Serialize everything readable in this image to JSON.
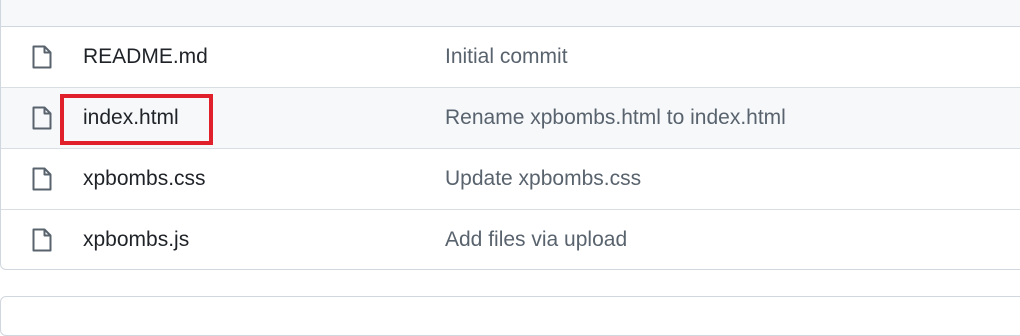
{
  "files": [
    {
      "name": "README.md",
      "commit_message": "Initial commit",
      "icon": "file-icon"
    },
    {
      "name": "index.html",
      "commit_message": "Rename xpbombs.html to index.html",
      "icon": "file-icon",
      "highlighted": true
    },
    {
      "name": "xpbombs.css",
      "commit_message": "Update xpbombs.css",
      "icon": "file-icon"
    },
    {
      "name": "xpbombs.js",
      "commit_message": "Add files via upload",
      "icon": "file-icon"
    }
  ],
  "colors": {
    "highlight": "#e0202a",
    "border": "#d0d7de",
    "header_bg": "#f6f8fa",
    "commit_text": "#59636e"
  }
}
